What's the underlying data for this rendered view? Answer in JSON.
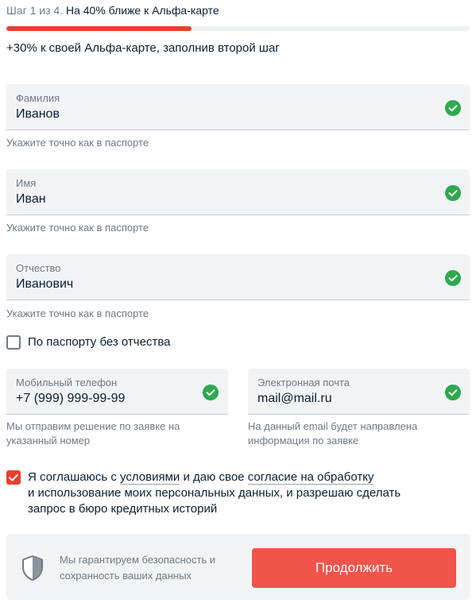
{
  "step": {
    "counter": "Шаг 1 из 4.",
    "title": "На 40% ближе к Альфа-карте",
    "progress_fraction": 0.4
  },
  "bonus_text": "+30% к своей Альфа-карте, заполнив второй шаг",
  "fields": {
    "last_name": {
      "label": "Фамилия",
      "value": "Иванов",
      "hint": "Укажите точно как в паспорте",
      "icon": "check-circle-icon"
    },
    "first_name": {
      "label": "Имя",
      "value": "Иван",
      "hint": "Укажите точно как в паспорте",
      "icon": "check-circle-icon"
    },
    "patronymic": {
      "label": "Отчество",
      "value": "Иванович",
      "hint": "Укажите точно как в паспорте",
      "icon": "check-circle-icon"
    },
    "phone": {
      "label": "Мобильный телефон",
      "value": "+7 (999) 999-99-99",
      "hint_line1": "Мы отправим решение по заявке на",
      "hint_line2": "указанный номер",
      "icon": "check-circle-icon"
    },
    "email": {
      "label": "Электронная почта",
      "value": "mail@mail.ru",
      "hint_line1": "На данный email будет направлена",
      "hint_line2": "информация по заявке",
      "icon": "check-circle-icon"
    }
  },
  "no_patronymic": {
    "label": "По паспорту без отчества",
    "checked": false
  },
  "consent": {
    "checked": true,
    "text_part1": "Я соглашаюсь с ",
    "link1": "условиями",
    "text_part2": " и даю свое ",
    "link2": "согласие на обработку",
    "line2": "и использование моих персональных данных, и разрешаю сделать",
    "line3": "запрос в бюро кредитных историй"
  },
  "footer": {
    "icon": "shield-icon",
    "guarantee_line1": "Мы гарантируем безопасность и",
    "guarantee_line2": "сохранность ваших данных",
    "continue_label": "Продолжить"
  },
  "colors": {
    "accent": "#e9402f",
    "button": "#f0544a",
    "success": "#2da94f",
    "field_bg": "#f2f3f5",
    "muted_text": "#6f7a87",
    "text": "#0b1f35"
  }
}
